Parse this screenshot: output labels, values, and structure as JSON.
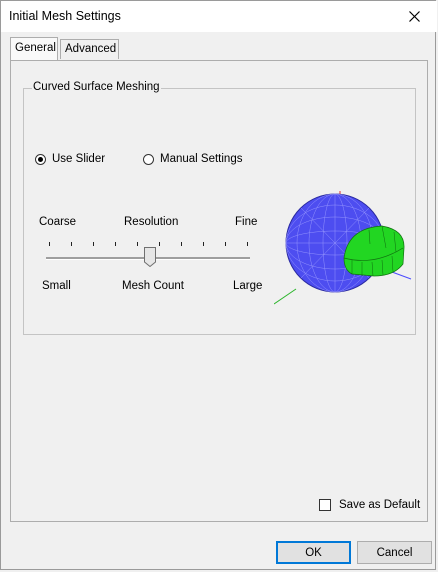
{
  "window": {
    "title": "Initial Mesh Settings"
  },
  "tabs": [
    {
      "label": "General",
      "active": true
    },
    {
      "label": "Advanced",
      "active": false
    }
  ],
  "group": {
    "title": "Curved Surface Meshing"
  },
  "options": {
    "use_slider": {
      "label": "Use Slider",
      "checked": true
    },
    "manual": {
      "label": "Manual Settings",
      "checked": false
    }
  },
  "slider": {
    "top_left": "Coarse",
    "top_center": "Resolution",
    "top_right": "Fine",
    "bottom_left": "Small",
    "bottom_center": "Mesh Count",
    "bottom_right": "Large",
    "tick_count": 10,
    "value_tick": 5
  },
  "save_default": {
    "label": "Save as Default",
    "checked": false
  },
  "buttons": {
    "ok": "OK",
    "cancel": "Cancel"
  },
  "colors": {
    "sphere": "#4d4df0",
    "ring": "#22d622",
    "axis_x": "#4a4aff",
    "axis_y": "#2bb52b",
    "axis_z": "#e03030"
  }
}
